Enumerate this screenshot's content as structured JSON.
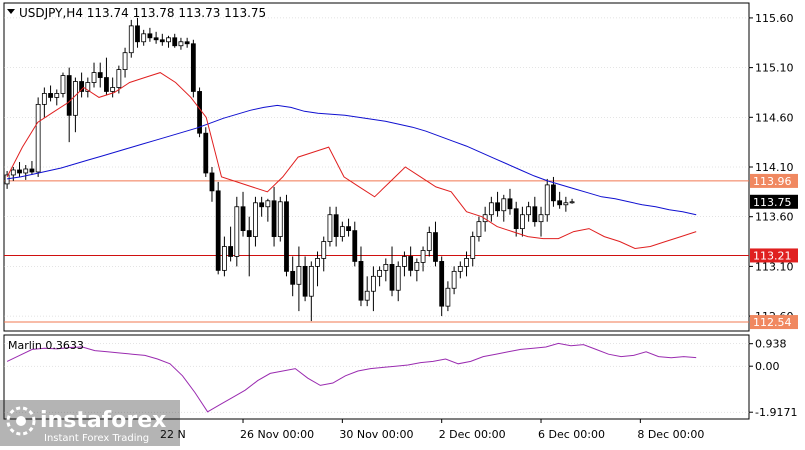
{
  "instrument_header": "USDJPY,H4  113.74 113.78 113.73 113.75",
  "oscillator_label": "Marlin 0.3633",
  "watermark": {
    "brand": "instaforex",
    "tagline": "Instant Forex Trading"
  },
  "colors": {
    "background": "#ffffff",
    "frame": "#000000",
    "grid": "#c8c8c8",
    "ma_blue": "#1010d0",
    "ma_red": "#e02020",
    "oscillator": "#9a2bb0",
    "level_line": "#f07850",
    "support_line": "#d01010",
    "label_orange": "#f08860",
    "label_red": "#e02020",
    "label_current": "#000000"
  },
  "chart_data": {
    "type": "candlestick",
    "symbol": "USDJPY",
    "timeframe": "H4",
    "ohlc_header": {
      "open": 113.74,
      "high": 113.78,
      "low": 113.73,
      "close": 113.75
    },
    "y_axis": {
      "ylim": [
        112.45,
        115.75
      ],
      "ticks": [
        "115.60",
        "115.10",
        "114.60",
        "114.10",
        "113.60",
        "113.10",
        "112.60"
      ]
    },
    "x_axis": {
      "ticks": [
        {
          "index": 38,
          "label": "26 Nov 00:00"
        },
        {
          "index": 54,
          "label": "30 Nov 00:00"
        },
        {
          "index": 70,
          "label": "2 Dec 00:00"
        },
        {
          "index": 86,
          "label": "6 Dec 00:00"
        },
        {
          "index": 102,
          "label": "8 Dec 00:00"
        }
      ],
      "partial_first_label": "22 N"
    },
    "levels": [
      {
        "value": 113.96,
        "label": "113.96",
        "style": "orange"
      },
      {
        "value": 113.21,
        "label": "113.21",
        "style": "red"
      },
      {
        "value": 112.54,
        "label": "112.54",
        "style": "orange"
      }
    ],
    "current_price": {
      "value": 113.75,
      "label": "113.75"
    },
    "candles": [
      [
        113.93,
        114.06,
        113.88,
        114.02
      ],
      [
        114.02,
        114.1,
        113.96,
        114.07
      ],
      [
        114.07,
        114.15,
        114.0,
        114.04
      ],
      [
        114.04,
        114.12,
        113.97,
        114.08
      ],
      [
        114.08,
        114.16,
        114.02,
        114.05
      ],
      [
        114.05,
        114.8,
        114.0,
        114.73
      ],
      [
        114.73,
        114.9,
        114.6,
        114.84
      ],
      [
        114.84,
        114.92,
        114.76,
        114.8
      ],
      [
        114.8,
        114.88,
        114.72,
        114.84
      ],
      [
        114.84,
        115.05,
        114.8,
        115.02
      ],
      [
        115.02,
        115.1,
        114.35,
        114.62
      ],
      [
        114.62,
        115.0,
        114.45,
        114.96
      ],
      [
        114.96,
        115.05,
        114.8,
        114.86
      ],
      [
        114.86,
        115.0,
        114.8,
        114.95
      ],
      [
        114.95,
        115.15,
        114.9,
        115.05
      ],
      [
        115.05,
        115.15,
        114.9,
        115.0
      ],
      [
        115.0,
        115.2,
        114.82,
        114.86
      ],
      [
        114.86,
        115.0,
        114.8,
        114.9
      ],
      [
        114.9,
        115.12,
        114.84,
        115.08
      ],
      [
        115.08,
        115.3,
        115.0,
        115.25
      ],
      [
        115.25,
        115.58,
        115.2,
        115.52
      ],
      [
        115.52,
        115.6,
        115.3,
        115.36
      ],
      [
        115.36,
        115.48,
        115.32,
        115.44
      ],
      [
        115.44,
        115.5,
        115.36,
        115.4
      ],
      [
        115.4,
        115.46,
        115.34,
        115.38
      ],
      [
        115.38,
        115.44,
        115.32,
        115.36
      ],
      [
        115.36,
        115.42,
        115.3,
        115.4
      ],
      [
        115.4,
        115.44,
        115.3,
        115.32
      ],
      [
        115.32,
        115.4,
        115.28,
        115.36
      ],
      [
        115.36,
        115.4,
        115.3,
        115.34
      ],
      [
        115.34,
        115.38,
        114.8,
        114.86
      ],
      [
        114.86,
        114.9,
        114.4,
        114.44
      ],
      [
        114.44,
        114.5,
        114.0,
        114.04
      ],
      [
        114.04,
        114.1,
        113.75,
        113.86
      ],
      [
        113.86,
        113.95,
        113.02,
        113.06
      ],
      [
        113.06,
        113.4,
        113.0,
        113.3
      ],
      [
        113.3,
        113.5,
        113.15,
        113.2
      ],
      [
        113.2,
        113.8,
        113.1,
        113.7
      ],
      [
        113.7,
        113.85,
        113.4,
        113.46
      ],
      [
        113.46,
        113.6,
        113.0,
        113.4
      ],
      [
        113.4,
        113.8,
        113.3,
        113.74
      ],
      [
        113.74,
        113.8,
        113.6,
        113.7
      ],
      [
        113.7,
        113.78,
        113.55,
        113.76
      ],
      [
        113.76,
        113.9,
        113.3,
        113.4
      ],
      [
        113.4,
        113.8,
        113.35,
        113.75
      ],
      [
        113.75,
        113.82,
        113.0,
        113.05
      ],
      [
        113.05,
        113.2,
        112.8,
        112.92
      ],
      [
        112.92,
        113.3,
        112.65,
        113.1
      ],
      [
        113.1,
        113.2,
        112.75,
        112.8
      ],
      [
        112.8,
        113.15,
        112.55,
        113.1
      ],
      [
        113.1,
        113.25,
        112.9,
        113.18
      ],
      [
        113.18,
        113.4,
        113.05,
        113.35
      ],
      [
        113.35,
        113.7,
        113.3,
        113.62
      ],
      [
        113.62,
        113.7,
        113.3,
        113.4
      ],
      [
        113.4,
        113.55,
        113.35,
        113.5
      ],
      [
        113.5,
        113.58,
        113.4,
        113.46
      ],
      [
        113.46,
        113.55,
        113.1,
        113.15
      ],
      [
        113.15,
        113.3,
        112.7,
        112.76
      ],
      [
        112.76,
        113.0,
        112.7,
        112.85
      ],
      [
        112.85,
        113.1,
        112.65,
        113.0
      ],
      [
        113.0,
        113.1,
        112.9,
        113.06
      ],
      [
        113.06,
        113.18,
        112.95,
        113.12
      ],
      [
        113.12,
        113.3,
        112.8,
        112.86
      ],
      [
        112.86,
        113.15,
        112.75,
        113.1
      ],
      [
        113.1,
        113.25,
        113.0,
        113.2
      ],
      [
        113.2,
        113.3,
        113.0,
        113.06
      ],
      [
        113.06,
        113.18,
        112.95,
        113.14
      ],
      [
        113.14,
        113.3,
        113.05,
        113.26
      ],
      [
        113.26,
        113.5,
        113.2,
        113.44
      ],
      [
        113.44,
        113.55,
        113.1,
        113.15
      ],
      [
        113.15,
        113.2,
        112.6,
        112.7
      ],
      [
        112.7,
        112.95,
        112.65,
        112.88
      ],
      [
        112.88,
        113.1,
        112.82,
        113.05
      ],
      [
        113.05,
        113.15,
        112.98,
        113.1
      ],
      [
        113.1,
        113.25,
        113.0,
        113.18
      ],
      [
        113.18,
        113.45,
        113.1,
        113.4
      ],
      [
        113.4,
        113.6,
        113.35,
        113.55
      ],
      [
        113.55,
        113.7,
        113.45,
        113.62
      ],
      [
        113.62,
        113.8,
        113.55,
        113.74
      ],
      [
        113.74,
        113.85,
        113.6,
        113.66
      ],
      [
        113.66,
        113.82,
        113.55,
        113.78
      ],
      [
        113.78,
        113.88,
        113.62,
        113.68
      ],
      [
        113.68,
        113.75,
        113.4,
        113.48
      ],
      [
        113.48,
        113.7,
        113.4,
        113.62
      ],
      [
        113.62,
        113.75,
        113.55,
        113.7
      ],
      [
        113.7,
        113.8,
        113.5,
        113.55
      ],
      [
        113.55,
        113.7,
        113.4,
        113.62
      ],
      [
        113.62,
        113.98,
        113.55,
        113.92
      ],
      [
        113.92,
        114.0,
        113.7,
        113.76
      ],
      [
        113.76,
        113.85,
        113.68,
        113.72
      ],
      [
        113.72,
        113.8,
        113.65,
        113.74
      ],
      [
        113.74,
        113.78,
        113.73,
        113.75
      ]
    ],
    "candle_slots": {
      "first_index": 0,
      "slot_indices": [
        0,
        1,
        2,
        3,
        4,
        5,
        6,
        7,
        8,
        9,
        10,
        11,
        12,
        13,
        14,
        15,
        16,
        17,
        18,
        19,
        20,
        21,
        22,
        23,
        24,
        25,
        26,
        27,
        28,
        29,
        30,
        31,
        32,
        33,
        34,
        35,
        36,
        37,
        38,
        39,
        40,
        41,
        42,
        43,
        44,
        45,
        46,
        47,
        48,
        49,
        50,
        51,
        52,
        53,
        54,
        55,
        56,
        57,
        58,
        59,
        60,
        61,
        62,
        63,
        64,
        65,
        66,
        67,
        68,
        69,
        70,
        71,
        72,
        73,
        74,
        75,
        76,
        77,
        78,
        79,
        80,
        81,
        82,
        83,
        84,
        85,
        86,
        87,
        88,
        89,
        90,
        91,
        92,
        93,
        94,
        95,
        96,
        97,
        98,
        99,
        100,
        101,
        102,
        103,
        104,
        105,
        106,
        107,
        108,
        109,
        110,
        111
      ]
    },
    "series_ma_blue": [
      113.98,
      114.0,
      114.03,
      114.06,
      114.09,
      114.13,
      114.17,
      114.21,
      114.25,
      114.29,
      114.33,
      114.37,
      114.41,
      114.45,
      114.49,
      114.54,
      114.59,
      114.63,
      114.67,
      114.7,
      114.72,
      114.7,
      114.66,
      114.64,
      114.63,
      114.62,
      114.6,
      114.58,
      114.56,
      114.53,
      114.5,
      114.46,
      114.41,
      114.36,
      114.31,
      114.25,
      114.19,
      114.13,
      114.07,
      114.01,
      113.96,
      113.92,
      113.88,
      113.84,
      113.8,
      113.78,
      113.75,
      113.72,
      113.7,
      113.67,
      113.65,
      113.62
    ],
    "series_ma_red": [
      114.0,
      114.3,
      114.55,
      114.65,
      114.75,
      114.9,
      114.8,
      114.85,
      114.95,
      115.0,
      115.05,
      114.95,
      114.8,
      114.6,
      114.0,
      113.95,
      113.9,
      113.85,
      114.0,
      114.2,
      114.25,
      114.3,
      114.0,
      113.9,
      113.8,
      113.95,
      114.1,
      114.0,
      113.9,
      113.85,
      113.65,
      113.6,
      113.5,
      113.45,
      113.4,
      113.38,
      113.38,
      113.45,
      113.48,
      113.4,
      113.35,
      113.28,
      113.3,
      113.35,
      113.4,
      113.45
    ],
    "oscillator": {
      "name": "Marlin",
      "value": 0.3633,
      "ylim": [
        -2.2,
        1.3
      ],
      "ticks": [
        "0.938",
        "0.00",
        "-1.9171"
      ],
      "values": [
        0.2,
        0.45,
        0.7,
        0.75,
        0.72,
        0.78,
        0.8,
        0.65,
        0.6,
        0.55,
        0.5,
        0.45,
        0.3,
        0.1,
        -0.4,
        -1.1,
        -1.9,
        -1.6,
        -1.3,
        -1.0,
        -0.6,
        -0.3,
        -0.2,
        -0.1,
        -0.5,
        -0.8,
        -0.7,
        -0.4,
        -0.2,
        -0.1,
        -0.05,
        0.0,
        0.05,
        0.15,
        0.2,
        0.3,
        0.1,
        0.2,
        0.4,
        0.5,
        0.6,
        0.7,
        0.75,
        0.8,
        0.95,
        0.85,
        0.9,
        0.7,
        0.5,
        0.4,
        0.45,
        0.6,
        0.4,
        0.35,
        0.4,
        0.36
      ]
    }
  }
}
